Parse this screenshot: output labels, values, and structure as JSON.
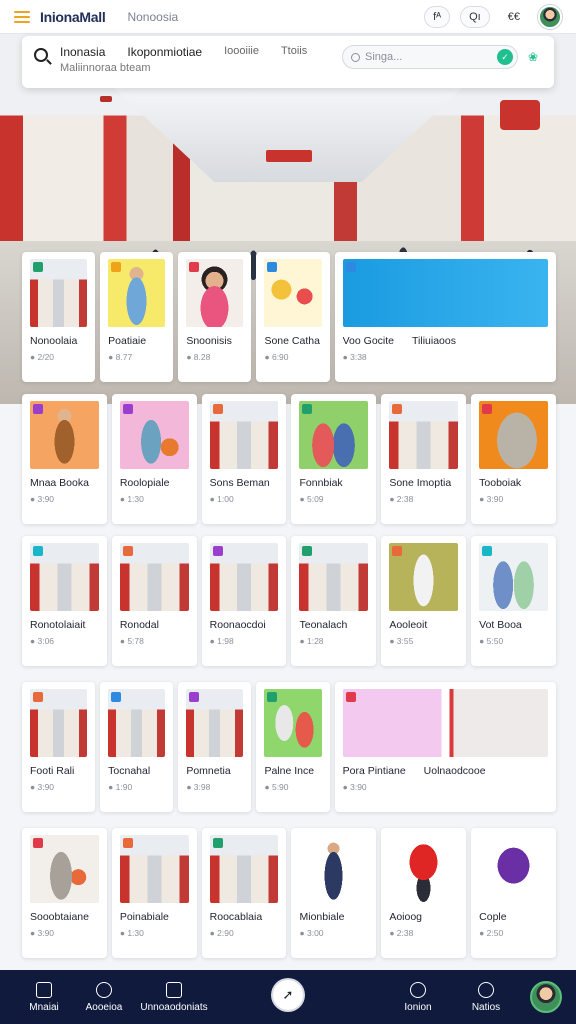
{
  "app": {
    "brand": "InionaMall",
    "subtitle": "Nonoosia",
    "pill_left": "fᴬ",
    "pill_mid": "Qı",
    "pill_right": "€€"
  },
  "nav": {
    "links": [
      "Inonasia",
      "Ikoponmiotiae",
      "Ioooiiie",
      "Ttoiis"
    ],
    "sub_label": "Maliinnoraa bteam",
    "search_placeholder": "Singa..."
  },
  "colors": {
    "brand": "#22305a",
    "accent": "#1fbf8f",
    "nav_bg": "#0f1a3d"
  },
  "grid": {
    "rows": [
      [
        {
          "title": "Nonoolaia",
          "meta": "● 2/20",
          "badge": "#21a06d",
          "thumb": "mall"
        },
        {
          "title": "Poatiaie",
          "meta": "● 8.77",
          "badge": "#f0a21a",
          "thumb": "yellow-person"
        },
        {
          "title": "Snoonisis",
          "meta": "● 8.28",
          "badge": "#e13a4a",
          "thumb": "woman"
        },
        {
          "title": "Sone Catha",
          "meta": "● 6:90",
          "badge": "#2d8ae0",
          "thumb": "toys"
        },
        {
          "title": "Voo Gocite",
          "meta": "● 3:38",
          "badge": "#2d8ae0",
          "thumb": "promo",
          "wide": true,
          "extra": "Tiliuiaoos"
        }
      ],
      [
        {
          "title": "Mnaa Booka",
          "meta": "● 3:90",
          "badge": "#9a3ed0",
          "thumb": "orange-person"
        },
        {
          "title": "Roolopiale",
          "meta": "● 1:30",
          "badge": "#9a3ed0",
          "thumb": "pink-shopper"
        },
        {
          "title": "Sons Beman",
          "meta": "● 1:00",
          "badge": "#e8693a",
          "thumb": "mall"
        },
        {
          "title": "Fonnbiak",
          "meta": "● 5:09",
          "badge": "#21a06d",
          "thumb": "green-people"
        },
        {
          "title": "Sone Imoptia",
          "meta": "● 2:38",
          "badge": "#e8693a",
          "thumb": "mall"
        },
        {
          "title": "Tooboiak",
          "meta": "● 3:90",
          "badge": "#e13a4a",
          "thumb": "hijab"
        }
      ],
      [
        {
          "title": "Ronotolaiait",
          "meta": "● 3:06",
          "badge": "#18b6c9",
          "thumb": "mall"
        },
        {
          "title": "Ronodal",
          "meta": "● 5:78",
          "badge": "#e8693a",
          "thumb": "mall"
        },
        {
          "title": "Roonaocdoi",
          "meta": "● 1:98",
          "badge": "#9a3ed0",
          "thumb": "mall"
        },
        {
          "title": "Teonalach",
          "meta": "● 1:28",
          "badge": "#21a06d",
          "thumb": "mall"
        },
        {
          "title": "Aooleoit",
          "meta": "● 3:55",
          "badge": "#e8693a",
          "thumb": "mannequin"
        },
        {
          "title": "Vot Booa",
          "meta": "● 5:50",
          "badge": "#18b6c9",
          "thumb": "couple"
        }
      ],
      [
        {
          "title": "Footi Rali",
          "meta": "● 3:90",
          "badge": "#e8693a",
          "thumb": "mall"
        },
        {
          "title": "Tocnahal",
          "meta": "● 1:90",
          "badge": "#2d8ae0",
          "thumb": "mall"
        },
        {
          "title": "Pomnetia",
          "meta": "● 3:98",
          "badge": "#9a3ed0",
          "thumb": "mall"
        },
        {
          "title": "Palne Ince",
          "meta": "● 5:90",
          "badge": "#21a06d",
          "thumb": "green-clothes"
        },
        {
          "title": "Pora Pintiane",
          "meta": "● 3:90",
          "badge": "#e13a4a",
          "thumb": "promo2",
          "wide": true,
          "extra": "Uolnaodcooe"
        }
      ],
      [
        {
          "title": "Sooobtaiane",
          "meta": "● 3:90",
          "badge": "#e13a4a",
          "thumb": "shopper-bag"
        },
        {
          "title": "Poinabiale",
          "meta": "● 1:30",
          "badge": "#e8693a",
          "thumb": "mall"
        },
        {
          "title": "Roocablaia",
          "meta": "● 2:90",
          "badge": "#21a06d",
          "thumb": "mall"
        },
        {
          "title": "Mionbiale",
          "meta": "● 3:00",
          "badge": "",
          "thumb": "man-white"
        },
        {
          "title": "Aoioog",
          "meta": "● 2:38",
          "badge": "",
          "thumb": "red-shirt"
        },
        {
          "title": "Cople",
          "meta": "● 2:50",
          "badge": "",
          "thumb": "purple-shirt"
        }
      ]
    ]
  },
  "bottom_nav": {
    "items": [
      "Mnaiai",
      "Aooeioa",
      "Unnoaodoniats",
      "Ionion",
      "Natios"
    ]
  }
}
